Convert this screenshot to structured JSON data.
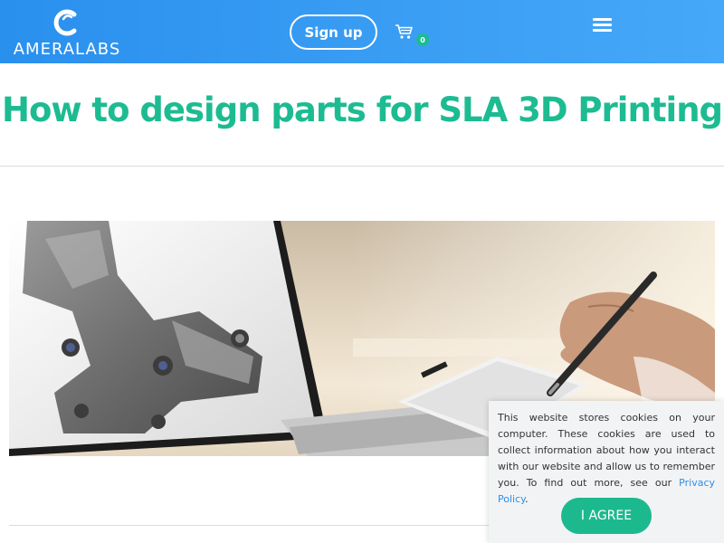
{
  "header": {
    "logo_bold": "AMERA",
    "logo_light": "LABS",
    "signup_label": "Sign up",
    "cart_count": "0",
    "brand_color": "#3a9ef5"
  },
  "icons": {
    "logo": "amera-labs-logo-icon",
    "cart": "shopping-cart-icon",
    "menu": "hamburger-menu-icon"
  },
  "main": {
    "title": "How to design parts for SLA 3D Printing",
    "title_color": "#1dbb91",
    "hero_image": "CAD model of a mechanical part on a laptop screen, hand holding a stylus over a drawing tablet"
  },
  "cookie_banner": {
    "text": "This website stores cookies on your computer. These cookies are used to collect information about how you interact with our website and allow us to remember you. To find out more, see our",
    "link_label": "Privacy Policy",
    "agree_label": "I AGREE",
    "button_color": "#1cb98f"
  }
}
